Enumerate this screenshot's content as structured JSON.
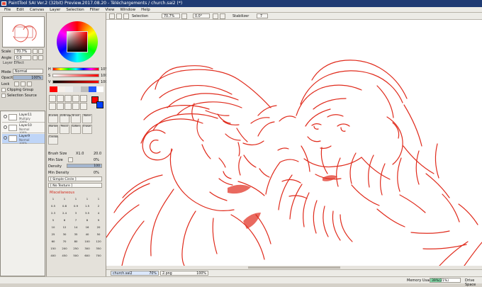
{
  "title": "PaintTool SAI Ver.2 (32bit) Preview.2017.08.20 - Téléchargements / church.sai2 (*)",
  "menu": [
    "File",
    "Edit",
    "Canvas",
    "Layer",
    "Selection",
    "Filter",
    "View",
    "Window",
    "Help"
  ],
  "toolbar": {
    "selection_label": "Selection",
    "zoom": "70.7%",
    "angle": "0.0°",
    "stabilizer_label": "Stabilizer",
    "stabilizer_value": "7"
  },
  "navigator": {
    "scale_label": "Scale",
    "scale_value": "70.7%",
    "angle_label": "Angle",
    "angle_value": "0.0"
  },
  "colors": {
    "main": "#ff0000",
    "secondary": "#0040ff",
    "line": "#e02b1c",
    "panel": "#d9d6cf"
  },
  "sliders": {
    "h_label": "H",
    "h_value": "105",
    "s_label": "S",
    "s_value": "100",
    "v_label": "V",
    "v_value": "100",
    "h_fill": 0.42,
    "s_fill": 1.0,
    "v_fill": 1.0
  },
  "layer_effect": {
    "title": "Layer Effect",
    "mode_label": "Mode",
    "mode_value": "Normal",
    "opacity_label": "Opacity",
    "opacity_value": "100%",
    "lock_label": "Lock",
    "clipping_label": "Clipping Group",
    "selection_source_label": "Selection Source"
  },
  "layers": [
    {
      "name": "Layer11",
      "mode": "Multiply",
      "opacity": "100%"
    },
    {
      "name": "Layer10",
      "mode": "Normal",
      "opacity": "100%"
    },
    {
      "name": "Layer9",
      "mode": "Normal",
      "opacity": "100%"
    }
  ],
  "tools": {
    "row1": [
      "Bucket",
      "AirBrush",
      "Brush",
      "Water"
    ],
    "row2": [
      "Marker",
      "Pencil",
      "Soften",
      "Eraser"
    ],
    "row3": [
      "Gradat."
    ]
  },
  "brush": {
    "size_label": "Brush Size",
    "size_mult": "X1.0",
    "size_value": "20.0",
    "min_size_label": "Min Size",
    "min_size_value": "0%",
    "density_label": "Density",
    "density_value": "100",
    "min_density_label": "Min Density",
    "min_density_value": "0%",
    "shape": "[ Simple Circle ]",
    "texture": "[ No Texture ]",
    "misc": "Miscellaneous"
  },
  "brush_sizes": {
    "row1": [
      "1",
      "1",
      "1",
      "1",
      "1"
    ],
    "row2": [
      "0.5",
      "0.8",
      "0.9",
      "1.5",
      "2"
    ],
    "row3": [
      "2.3",
      "2.4",
      "3",
      "3.5",
      "4"
    ],
    "row4": [
      "5",
      "6",
      "7",
      "8",
      "9"
    ],
    "row5": [
      "10",
      "12",
      "14",
      "16",
      "20"
    ],
    "row6": [
      "25",
      "30",
      "35",
      "40",
      "50"
    ],
    "row7": [
      "60",
      "70",
      "80",
      "100",
      "120"
    ],
    "row8": [
      "150",
      "200",
      "250",
      "300",
      "350"
    ],
    "row9": [
      "400",
      "450",
      "500",
      "600",
      "700"
    ]
  },
  "documents": [
    {
      "name": "church.sai2",
      "zoom": "70%"
    },
    {
      "name": "2.png",
      "zoom": "100%"
    }
  ],
  "status": {
    "memory_label": "Memory Usage",
    "memory_value": "39%(21%)",
    "memory_fill": 0.39,
    "drive_label": "Drive Space"
  }
}
